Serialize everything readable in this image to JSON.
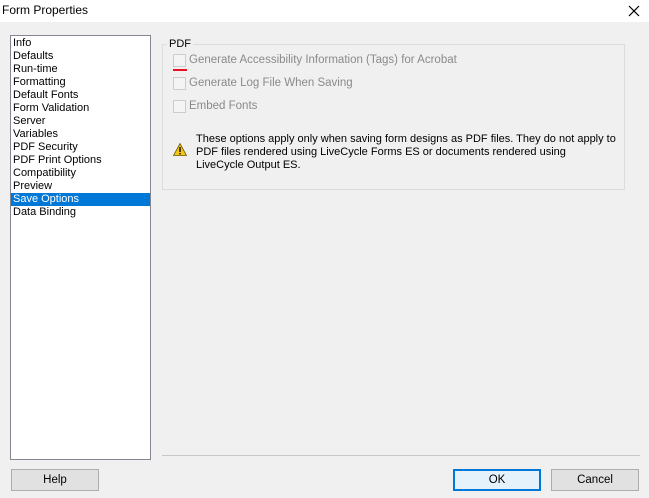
{
  "window": {
    "title": "Form Properties"
  },
  "sidebar": {
    "items": [
      {
        "label": "Info"
      },
      {
        "label": "Defaults"
      },
      {
        "label": "Run-time"
      },
      {
        "label": "Formatting"
      },
      {
        "label": "Default Fonts"
      },
      {
        "label": "Form Validation"
      },
      {
        "label": "Server"
      },
      {
        "label": "Variables"
      },
      {
        "label": "PDF Security"
      },
      {
        "label": "PDF Print Options"
      },
      {
        "label": "Compatibility"
      },
      {
        "label": "Preview"
      },
      {
        "label": "Save Options",
        "selected": true
      },
      {
        "label": "Data Binding"
      }
    ]
  },
  "pdf": {
    "group_label": "PDF",
    "options": [
      {
        "label": "Generate Accessibility Information (Tags) for Acrobat",
        "checked": false,
        "enabled": false
      },
      {
        "label": "Generate Log File When Saving",
        "checked": false,
        "enabled": false
      },
      {
        "label": "Embed Fonts",
        "checked": false,
        "enabled": false
      }
    ],
    "note": "These options apply only when saving form designs as PDF files. They do not apply to PDF files rendered using LiveCycle Forms ES or documents rendered using LiveCycle Output ES."
  },
  "buttons": {
    "help": "Help",
    "ok": "OK",
    "cancel": "Cancel"
  },
  "colors": {
    "selection": "#0078d7",
    "warning": "#f5c518",
    "disabled_text": "#8a8a8a"
  }
}
